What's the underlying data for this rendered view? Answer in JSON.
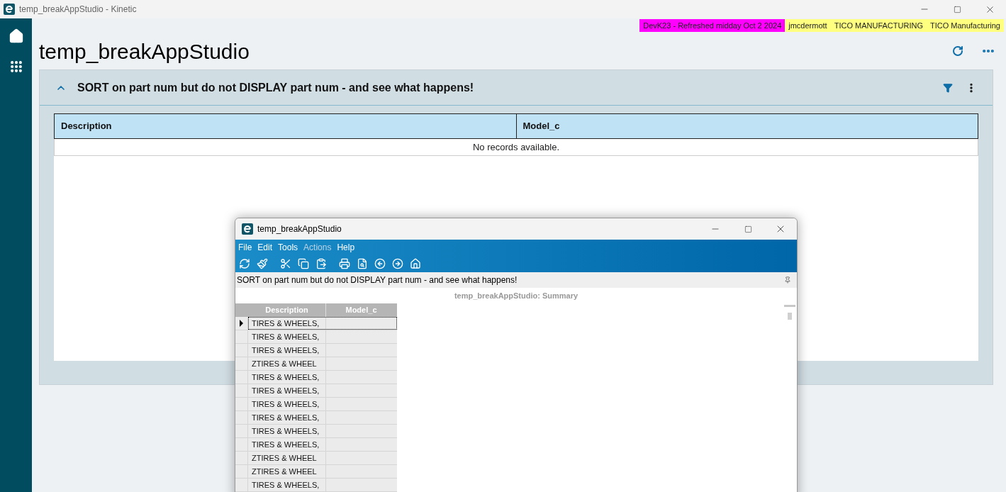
{
  "window": {
    "title": "temp_breakAppStudio - Kinetic"
  },
  "env_tags": [
    {
      "text": "DevK23 - Refreshed midday Oct 2 2024",
      "color": "#ff00ff"
    },
    {
      "text": "jmcdermott",
      "color": "#ffff80"
    },
    {
      "text": "TICO MANUFACTURING",
      "color": "#ffff80"
    },
    {
      "text": "TICO Manufacturing",
      "color": "#ffff80"
    }
  ],
  "page": {
    "title": "temp_breakAppStudio"
  },
  "panel": {
    "title": "SORT on part num but do not DISPLAY part num - and see what happens!",
    "expanded": true,
    "columns": [
      "Description",
      "Model_c"
    ],
    "empty_text": "No records available."
  },
  "dialog": {
    "title": "temp_breakAppStudio",
    "menu": [
      {
        "label": "File",
        "disabled": false
      },
      {
        "label": "Edit",
        "disabled": false
      },
      {
        "label": "Tools",
        "disabled": false
      },
      {
        "label": "Actions",
        "disabled": true
      },
      {
        "label": "Help",
        "disabled": false
      }
    ],
    "caption": "SORT on part num but do not DISPLAY part num - and see what happens!",
    "summary_title": "temp_breakAppStudio: Summary",
    "columns": [
      "Description",
      "Model_c"
    ],
    "rows": [
      {
        "description": "TIRES & WHEELS,",
        "selected": true
      },
      {
        "description": "TIRES & WHEELS,",
        "selected": false
      },
      {
        "description": "TIRES & WHEELS,",
        "selected": false
      },
      {
        "description": "ZTIRES & WHEEL",
        "selected": false
      },
      {
        "description": "TIRES & WHEELS,",
        "selected": false
      },
      {
        "description": "TIRES & WHEELS,",
        "selected": false
      },
      {
        "description": "TIRES & WHEELS,",
        "selected": false
      },
      {
        "description": "TIRES & WHEELS,",
        "selected": false
      },
      {
        "description": "TIRES & WHEELS,",
        "selected": false
      },
      {
        "description": "TIRES & WHEELS,",
        "selected": false
      },
      {
        "description": "ZTIRES & WHEEL",
        "selected": false
      },
      {
        "description": "ZTIRES & WHEEL",
        "selected": false
      },
      {
        "description": "TIRES & WHEELS,",
        "selected": false
      }
    ]
  }
}
